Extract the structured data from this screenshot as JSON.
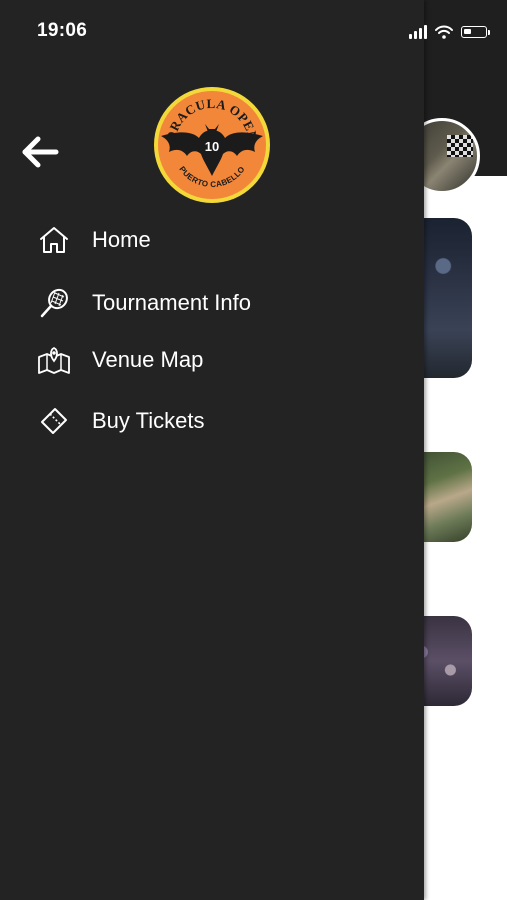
{
  "status_bar": {
    "time": "19:06",
    "battery_level": 0.35
  },
  "logo": {
    "top_text": "DRACULA OPEN",
    "number": "10",
    "bottom_text": "PUERTO CABELLO"
  },
  "menu": {
    "items": [
      {
        "label": "Home",
        "icon": "home-icon"
      },
      {
        "label": "Tournament Info",
        "icon": "tennis-racket-icon"
      },
      {
        "label": "Venue Map",
        "icon": "map-icon"
      },
      {
        "label": "Buy Tickets",
        "icon": "ticket-icon"
      }
    ]
  },
  "colors": {
    "drawer_bg": "#232323",
    "logo_orange": "#f2873a",
    "logo_yellow": "#f3d83a",
    "logo_dark": "#1b1b1b",
    "text": "#ffffff"
  }
}
